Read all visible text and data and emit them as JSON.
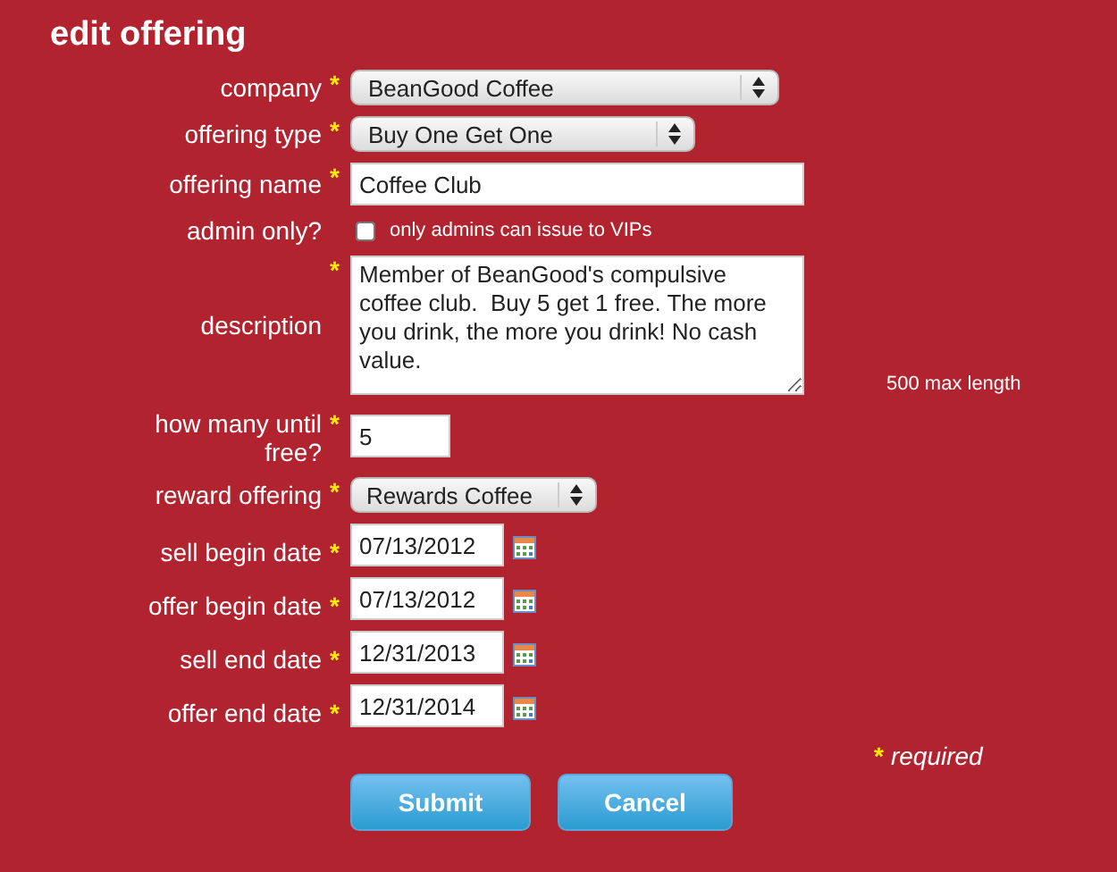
{
  "title": "edit offering",
  "fields": [
    {
      "kind": "select",
      "label": "company",
      "mark": "*",
      "value": "BeanGood Coffee"
    },
    {
      "kind": "select",
      "label": "offering type",
      "mark": "*",
      "value": "Buy One Get One"
    },
    {
      "kind": "text",
      "label": "offering name",
      "mark": "*",
      "value": "Coffee Club"
    },
    {
      "kind": "checkbox",
      "label": "admin only?",
      "checked": false,
      "text": "only admins can issue to VIPs"
    },
    {
      "kind": "textarea",
      "label": "description",
      "mark": "*",
      "value": "Member of BeanGood's compulsive coffee club.  Buy 5 get 1 free. The more you drink, the more you drink! No cash value.",
      "note": "500 max length"
    },
    {
      "kind": "number",
      "label": "how many until free?",
      "mark": "*",
      "value": "5"
    },
    {
      "kind": "select",
      "label": "reward offering",
      "mark": "*",
      "value": "Rewards Coffee"
    },
    {
      "kind": "date",
      "label": "sell begin date",
      "mark": "*",
      "value": "07/13/2012"
    },
    {
      "kind": "date",
      "label": "offer begin date",
      "mark": "*",
      "value": "07/13/2012"
    },
    {
      "kind": "date",
      "label": "sell end date",
      "mark": "*",
      "value": "12/31/2013"
    },
    {
      "kind": "date",
      "label": "offer end date",
      "mark": "*",
      "value": "12/31/2014"
    }
  ],
  "legend": {
    "mark": "*",
    "text": "required"
  },
  "buttons": [
    "Submit",
    "Cancel"
  ]
}
